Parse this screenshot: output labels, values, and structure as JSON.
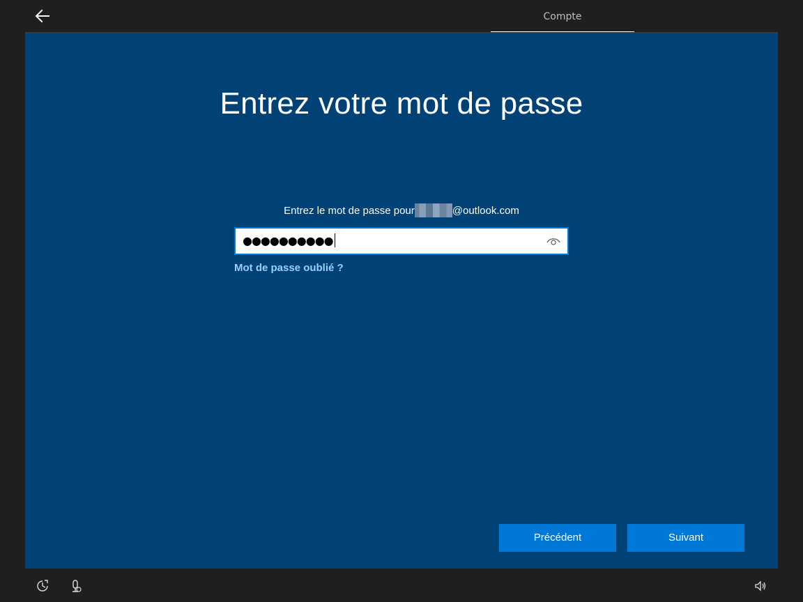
{
  "header": {
    "tab_label": "Compte"
  },
  "main": {
    "title": "Entrez votre mot de passe",
    "prompt_prefix": "Entrez le mot de passe pour",
    "prompt_email_domain": "@outlook.com",
    "password_mask": "●●●●●●●●●●",
    "forgot_link": "Mot de passe oublié ?"
  },
  "buttons": {
    "previous": "Précédent",
    "next": "Suivant"
  },
  "icons": {
    "back": "back-arrow-icon",
    "show_password": "eye-icon",
    "ease_of_access": "ease-of-access-icon",
    "microphone": "microphone-icon",
    "volume": "volume-icon"
  },
  "colors": {
    "panel_bg": "#004275",
    "accent": "#0078d7",
    "link": "#99d0ff",
    "chrome_bg": "#1f1f1f"
  }
}
